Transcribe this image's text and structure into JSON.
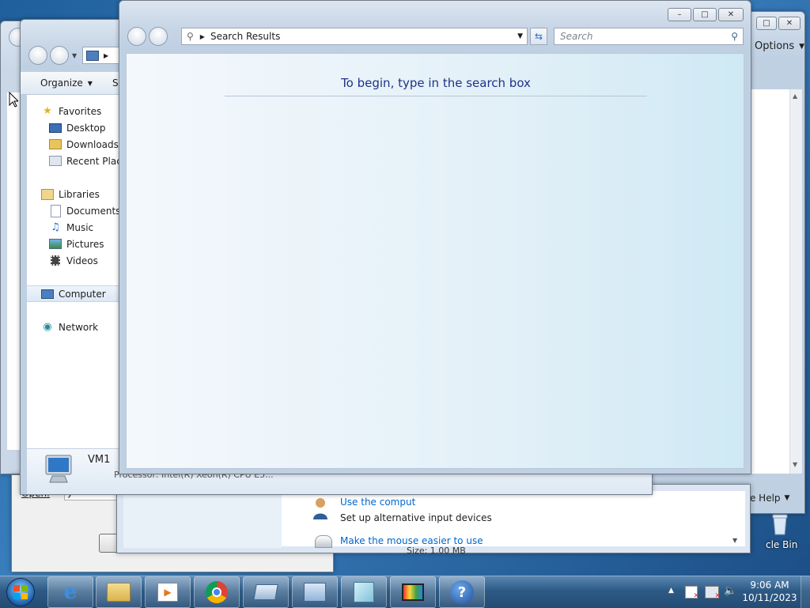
{
  "desktop": {
    "recycle_bin_label": "cle Bin"
  },
  "back_window": {
    "options_label": "Options",
    "offline_help_label": "Offline Help"
  },
  "ease_window": {
    "items": [
      {
        "label": "Use the comput",
        "kind": "link"
      },
      {
        "label": "Set up alternative input devices",
        "kind": "text"
      },
      {
        "label": "Make the mouse easier to use",
        "kind": "link"
      }
    ]
  },
  "run_dialog": {
    "open_label": "Open:",
    "open_value": "y",
    "size_text": "Size: 1.00 MB"
  },
  "explorer_window": {
    "organize_label": "Organize",
    "sy_label": "Sy",
    "nav": {
      "favorites": "Favorites",
      "desktop": "Desktop",
      "downloads": "Downloads",
      "recent": "Recent Place",
      "libraries": "Libraries",
      "documents": "Documents",
      "music": "Music",
      "pictures": "Pictures",
      "videos": "Videos",
      "computer": "Computer",
      "network": "Network"
    },
    "details_name": "VM1",
    "details_processor": "Processor: Intel(R) Xeon(R) CPU E5..."
  },
  "search_window": {
    "breadcrumb": "Search Results",
    "search_placeholder": "Search",
    "empty_message": "To begin, type in the search box"
  },
  "taskbar": {
    "time": "9:06 AM",
    "date": "10/11/2023",
    "apps": [
      "internet-explorer-icon",
      "file-explorer-icon",
      "media-player-icon",
      "chrome-icon",
      "remote-desktop-icon",
      "control-panel-icon",
      "notepad-icon",
      "paint-icon",
      "help-icon"
    ]
  },
  "colors": {
    "accent_text": "#1e3287",
    "link": "#0066cc",
    "taskbar": "#2d5a85"
  }
}
